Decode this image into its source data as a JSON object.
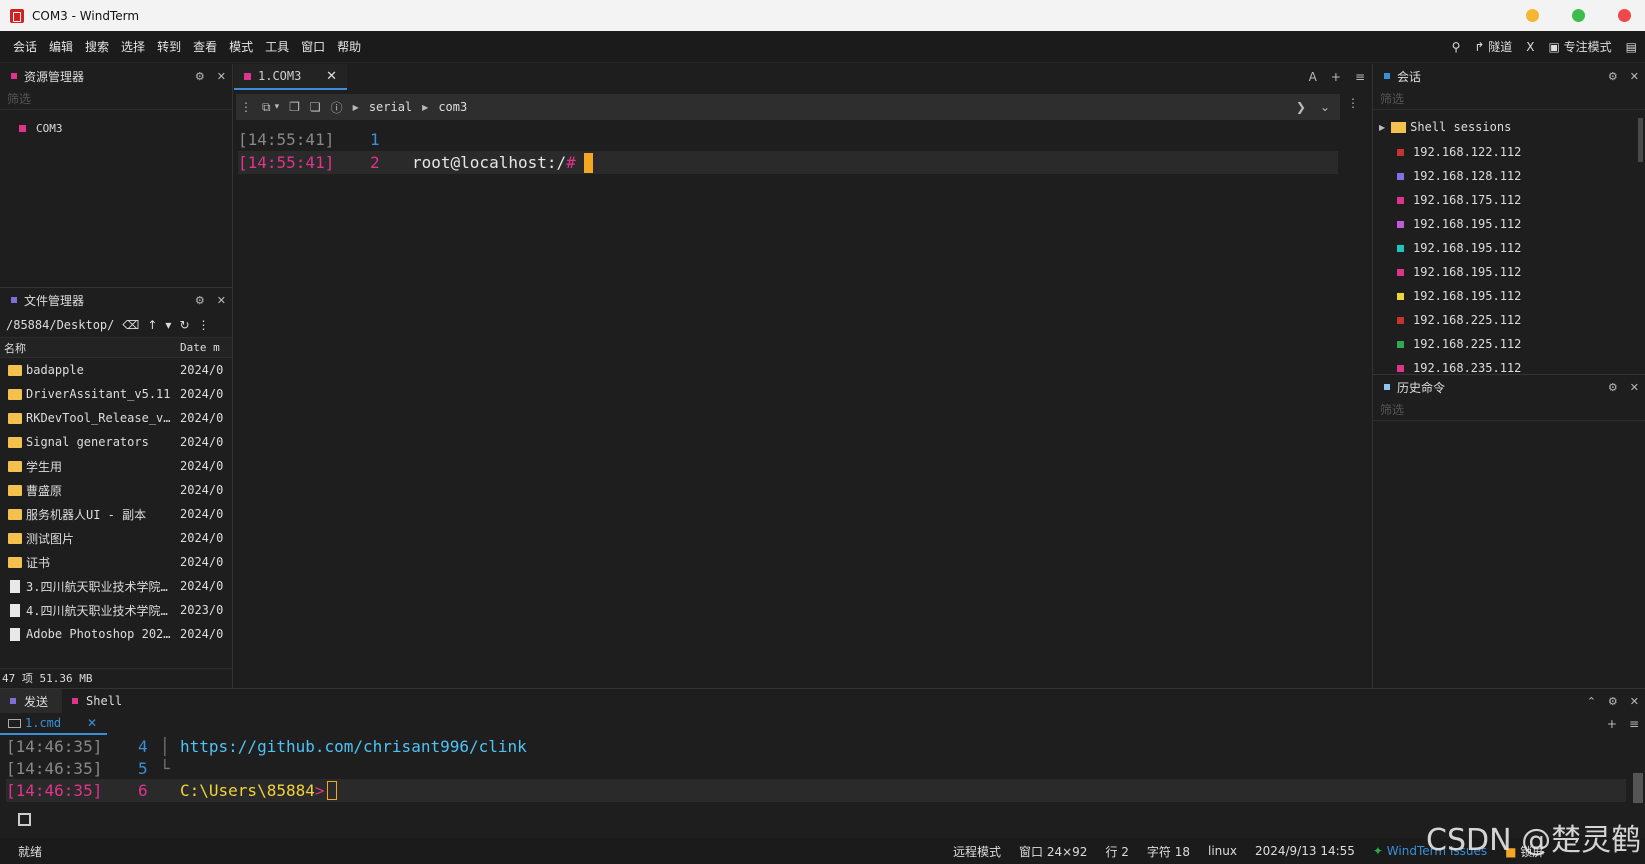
{
  "window": {
    "title": "COM3 - WindTerm",
    "min_color": "#f5b731",
    "max_color": "#3dbd4e",
    "close_color": "#ef4848"
  },
  "menu": {
    "items": [
      "会话",
      "编辑",
      "搜索",
      "选择",
      "转到",
      "查看",
      "模式",
      "工具",
      "窗口",
      "帮助"
    ],
    "right": {
      "tunnel": "隧道",
      "x": "X",
      "focus": "专注模式"
    }
  },
  "explorer": {
    "title": "资源管理器",
    "filter_placeholder": "筛选",
    "items": [
      {
        "label": "COM3",
        "color": "#e0338b"
      }
    ]
  },
  "filemgr": {
    "title": "文件管理器",
    "path": "/85884/Desktop/",
    "col_name": "名称",
    "col_date": "Date m",
    "rows": [
      {
        "name": "badapple",
        "date": "2024/0",
        "kind": "folder"
      },
      {
        "name": "DriverAssitant_v5.11",
        "date": "2024/0",
        "kind": "folder"
      },
      {
        "name": "RKDevTool_Release_v2…",
        "date": "2024/0",
        "kind": "folder"
      },
      {
        "name": "Signal generators",
        "date": "2024/0",
        "kind": "folder"
      },
      {
        "name": "学生用",
        "date": "2024/0",
        "kind": "folder"
      },
      {
        "name": "曹盛原",
        "date": "2024/0",
        "kind": "folder"
      },
      {
        "name": "服务机器人UI - 副本",
        "date": "2024/0",
        "kind": "folder"
      },
      {
        "name": "测试图片",
        "date": "2024/0",
        "kind": "folder"
      },
      {
        "name": "证书",
        "date": "2024/0",
        "kind": "folder"
      },
      {
        "name": "3.四川航天职业技术学院…",
        "date": "2024/0",
        "kind": "file"
      },
      {
        "name": "4.四川航天职业技术学院…",
        "date": "2023/0",
        "kind": "file"
      },
      {
        "name": "Adobe Photoshop 2021…",
        "date": "2024/0",
        "kind": "file"
      }
    ],
    "status": "47 项 51.36 MB"
  },
  "terminal": {
    "tab_label": "1.COM3",
    "tab_color": "#e0338b",
    "breadcrumb": [
      "serial",
      "com3"
    ],
    "tools_font": "A",
    "lines": [
      {
        "time": "[14:55:41]",
        "num": "1",
        "text": "",
        "prompt": ""
      },
      {
        "time": "[14:55:41]",
        "num": "2",
        "text": "root@localhost:/",
        "prompt": "#"
      }
    ]
  },
  "sessions": {
    "title": "会话",
    "filter_placeholder": "筛选",
    "group": "Shell sessions",
    "items": [
      {
        "ip": "192.168.122.112",
        "color": "#c8332f"
      },
      {
        "ip": "192.168.128.112",
        "color": "#8a6be8"
      },
      {
        "ip": "192.168.175.112",
        "color": "#e0338b"
      },
      {
        "ip": "192.168.195.112",
        "color": "#c05bd6"
      },
      {
        "ip": "192.168.195.112",
        "color": "#20c4c4"
      },
      {
        "ip": "192.168.195.112",
        "color": "#e0338b"
      },
      {
        "ip": "192.168.195.112",
        "color": "#f2d33a"
      },
      {
        "ip": "192.168.225.112",
        "color": "#c8332f"
      },
      {
        "ip": "192.168.225.112",
        "color": "#2fa84f"
      },
      {
        "ip": "192.168.235.112",
        "color": "#e0338b"
      }
    ]
  },
  "history": {
    "title": "历史命令",
    "filter_placeholder": "筛选"
  },
  "bottom": {
    "tabs": [
      {
        "label": "发送",
        "color": "#7c6fd8"
      },
      {
        "label": "Shell",
        "color": "#e0338b"
      }
    ],
    "cmd_tab": "1.cmd",
    "lines": [
      {
        "time": "[14:46:35]",
        "num": "4",
        "text": "https://github.com/chrisant996/clink",
        "prompt": ""
      },
      {
        "time": "[14:46:35]",
        "num": "5",
        "text": "",
        "prompt": ""
      },
      {
        "time": "[14:46:35]",
        "num": "6",
        "text": "C:\\Users\\85884",
        "prompt": ">"
      }
    ]
  },
  "statusbar": {
    "ready": "就绪",
    "remote_mode": "远程模式",
    "window_size": "窗口 24×92",
    "line": "行 2",
    "chars": "字符 18",
    "os": "linux",
    "datetime": "2024/9/13 14:55",
    "issues": "WindTerm Issues",
    "lock": "锁屏"
  },
  "watermark": "CSDN @楚灵鹤"
}
